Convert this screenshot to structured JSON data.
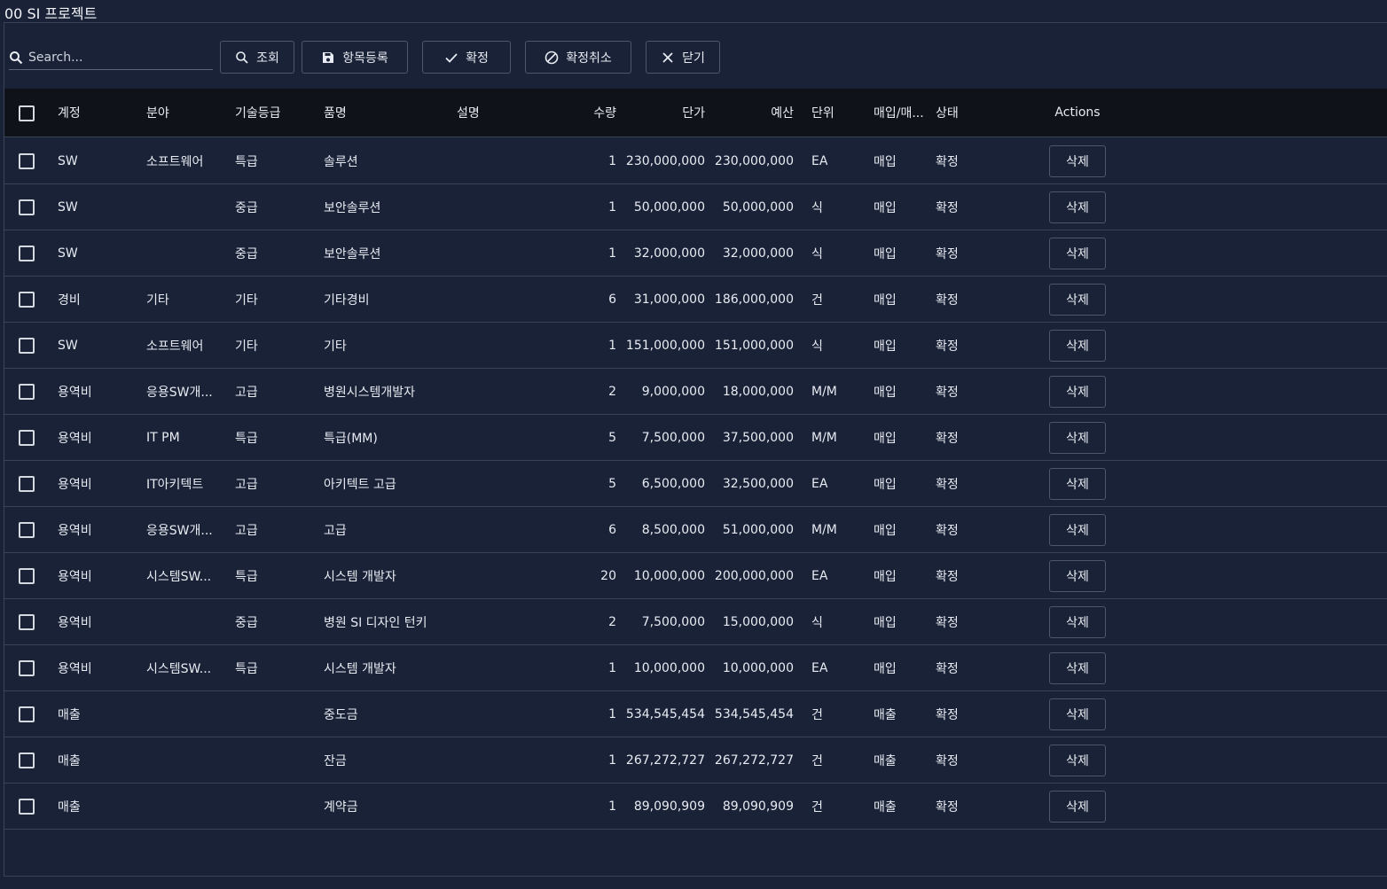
{
  "page": {
    "title": "00 SI 프로젝트"
  },
  "search": {
    "placeholder": "Search..."
  },
  "toolbar": {
    "query": "조회",
    "register": "항목등록",
    "confirm": "확정",
    "cancel_confirm": "확정취소",
    "close": "닫기"
  },
  "columns": [
    "계정",
    "분야",
    "기술등급",
    "품명",
    "설명",
    "수량",
    "단가",
    "예산",
    "단위",
    "매입/매...",
    "상태",
    "Actions"
  ],
  "delete_label": "삭제",
  "rows": [
    [
      "SW",
      "소프트웨어",
      "특급",
      "솔루션",
      "",
      "1",
      "230,000,000",
      "230,000,000",
      "EA",
      "매입",
      "확정"
    ],
    [
      "SW",
      "",
      "중급",
      "보안솔루션",
      "",
      "1",
      "50,000,000",
      "50,000,000",
      "식",
      "매입",
      "확정"
    ],
    [
      "SW",
      "",
      "중급",
      "보안솔루션",
      "",
      "1",
      "32,000,000",
      "32,000,000",
      "식",
      "매입",
      "확정"
    ],
    [
      "경비",
      "기타",
      "기타",
      "기타경비",
      "",
      "6",
      "31,000,000",
      "186,000,000",
      "건",
      "매입",
      "확정"
    ],
    [
      "SW",
      "소프트웨어",
      "기타",
      "기타",
      "",
      "1",
      "151,000,000",
      "151,000,000",
      "식",
      "매입",
      "확정"
    ],
    [
      "용역비",
      "응용SW개...",
      "고급",
      "병원시스템개발자",
      "",
      "2",
      "9,000,000",
      "18,000,000",
      "M/M",
      "매입",
      "확정"
    ],
    [
      "용역비",
      "IT PM",
      "특급",
      "특급(MM)",
      "",
      "5",
      "7,500,000",
      "37,500,000",
      "M/M",
      "매입",
      "확정"
    ],
    [
      "용역비",
      "IT아키텍트",
      "고급",
      "아키텍트 고급",
      "",
      "5",
      "6,500,000",
      "32,500,000",
      "EA",
      "매입",
      "확정"
    ],
    [
      "용역비",
      "응용SW개...",
      "고급",
      "고급",
      "",
      "6",
      "8,500,000",
      "51,000,000",
      "M/M",
      "매입",
      "확정"
    ],
    [
      "용역비",
      "시스템SW...",
      "특급",
      "시스템 개발자",
      "",
      "20",
      "10,000,000",
      "200,000,000",
      "EA",
      "매입",
      "확정"
    ],
    [
      "용역비",
      "",
      "중급",
      "병원 SI 디자인 턴키",
      "",
      "2",
      "7,500,000",
      "15,000,000",
      "식",
      "매입",
      "확정"
    ],
    [
      "용역비",
      "시스템SW...",
      "특급",
      "시스템 개발자",
      "",
      "1",
      "10,000,000",
      "10,000,000",
      "EA",
      "매입",
      "확정"
    ],
    [
      "매출",
      "",
      "",
      "중도금",
      "",
      "1",
      "534,545,454",
      "534,545,454",
      "건",
      "매출",
      "확정"
    ],
    [
      "매출",
      "",
      "",
      "잔금",
      "",
      "1",
      "267,272,727",
      "267,272,727",
      "건",
      "매출",
      "확정"
    ],
    [
      "매출",
      "",
      "",
      "계약금",
      "",
      "1",
      "89,090,909",
      "89,090,909",
      "건",
      "매출",
      "확정"
    ]
  ]
}
